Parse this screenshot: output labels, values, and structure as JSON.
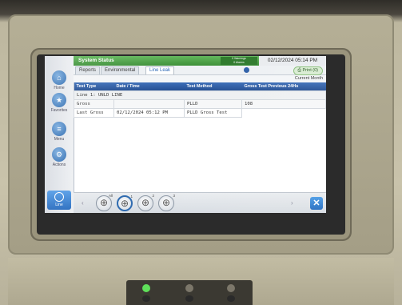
{
  "status_bar": {
    "title": "System Status",
    "alarm_line1": "0 Warnings",
    "alarm_line2": "0 Alarms",
    "datetime": "02/12/2024 05:14 PM"
  },
  "sidebar": {
    "home": "Home",
    "favorites": "Favorites",
    "menu": "Menu",
    "actions": "Actions",
    "line": "Line"
  },
  "tabs": {
    "reports": "Reports",
    "environmental": "Environmental",
    "line_leak": "Line Leak"
  },
  "print_label": "Print (0)",
  "period_label": "Current Month",
  "table": {
    "headers": [
      "Test Type",
      "Date / Time",
      "Test Method",
      "Gross Test Previous 24Hs"
    ],
    "group_label": "Line 1: UNLD LINE",
    "summary_row": [
      "Gross",
      "",
      "PLLD",
      "108"
    ],
    "detail_row": [
      "Last Gross",
      "02/12/2024 05:12 PM",
      "PLLD Gross Test",
      ""
    ]
  },
  "bottom_nav": {
    "tags": [
      "All",
      "1",
      "2",
      "3"
    ]
  },
  "colors": {
    "status_green": "#4aa043",
    "header_blue": "#2f5ea6",
    "accent_blue": "#2f6bb0"
  }
}
